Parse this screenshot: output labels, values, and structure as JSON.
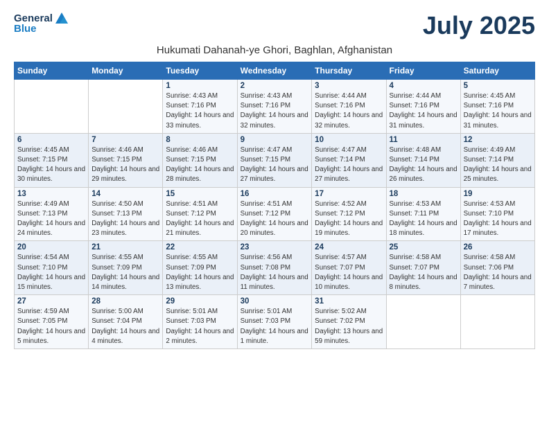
{
  "header": {
    "logo_general": "General",
    "logo_blue": "Blue",
    "month_title": "July 2025",
    "subtitle": "Hukumati Dahanah-ye Ghori, Baghlan, Afghanistan"
  },
  "weekdays": [
    "Sunday",
    "Monday",
    "Tuesday",
    "Wednesday",
    "Thursday",
    "Friday",
    "Saturday"
  ],
  "weeks": [
    [
      {
        "day": "",
        "detail": ""
      },
      {
        "day": "",
        "detail": ""
      },
      {
        "day": "1",
        "detail": "Sunrise: 4:43 AM\nSunset: 7:16 PM\nDaylight: 14 hours and 33 minutes."
      },
      {
        "day": "2",
        "detail": "Sunrise: 4:43 AM\nSunset: 7:16 PM\nDaylight: 14 hours and 32 minutes."
      },
      {
        "day": "3",
        "detail": "Sunrise: 4:44 AM\nSunset: 7:16 PM\nDaylight: 14 hours and 32 minutes."
      },
      {
        "day": "4",
        "detail": "Sunrise: 4:44 AM\nSunset: 7:16 PM\nDaylight: 14 hours and 31 minutes."
      },
      {
        "day": "5",
        "detail": "Sunrise: 4:45 AM\nSunset: 7:16 PM\nDaylight: 14 hours and 31 minutes."
      }
    ],
    [
      {
        "day": "6",
        "detail": "Sunrise: 4:45 AM\nSunset: 7:15 PM\nDaylight: 14 hours and 30 minutes."
      },
      {
        "day": "7",
        "detail": "Sunrise: 4:46 AM\nSunset: 7:15 PM\nDaylight: 14 hours and 29 minutes."
      },
      {
        "day": "8",
        "detail": "Sunrise: 4:46 AM\nSunset: 7:15 PM\nDaylight: 14 hours and 28 minutes."
      },
      {
        "day": "9",
        "detail": "Sunrise: 4:47 AM\nSunset: 7:15 PM\nDaylight: 14 hours and 27 minutes."
      },
      {
        "day": "10",
        "detail": "Sunrise: 4:47 AM\nSunset: 7:14 PM\nDaylight: 14 hours and 27 minutes."
      },
      {
        "day": "11",
        "detail": "Sunrise: 4:48 AM\nSunset: 7:14 PM\nDaylight: 14 hours and 26 minutes."
      },
      {
        "day": "12",
        "detail": "Sunrise: 4:49 AM\nSunset: 7:14 PM\nDaylight: 14 hours and 25 minutes."
      }
    ],
    [
      {
        "day": "13",
        "detail": "Sunrise: 4:49 AM\nSunset: 7:13 PM\nDaylight: 14 hours and 24 minutes."
      },
      {
        "day": "14",
        "detail": "Sunrise: 4:50 AM\nSunset: 7:13 PM\nDaylight: 14 hours and 23 minutes."
      },
      {
        "day": "15",
        "detail": "Sunrise: 4:51 AM\nSunset: 7:12 PM\nDaylight: 14 hours and 21 minutes."
      },
      {
        "day": "16",
        "detail": "Sunrise: 4:51 AM\nSunset: 7:12 PM\nDaylight: 14 hours and 20 minutes."
      },
      {
        "day": "17",
        "detail": "Sunrise: 4:52 AM\nSunset: 7:12 PM\nDaylight: 14 hours and 19 minutes."
      },
      {
        "day": "18",
        "detail": "Sunrise: 4:53 AM\nSunset: 7:11 PM\nDaylight: 14 hours and 18 minutes."
      },
      {
        "day": "19",
        "detail": "Sunrise: 4:53 AM\nSunset: 7:10 PM\nDaylight: 14 hours and 17 minutes."
      }
    ],
    [
      {
        "day": "20",
        "detail": "Sunrise: 4:54 AM\nSunset: 7:10 PM\nDaylight: 14 hours and 15 minutes."
      },
      {
        "day": "21",
        "detail": "Sunrise: 4:55 AM\nSunset: 7:09 PM\nDaylight: 14 hours and 14 minutes."
      },
      {
        "day": "22",
        "detail": "Sunrise: 4:55 AM\nSunset: 7:09 PM\nDaylight: 14 hours and 13 minutes."
      },
      {
        "day": "23",
        "detail": "Sunrise: 4:56 AM\nSunset: 7:08 PM\nDaylight: 14 hours and 11 minutes."
      },
      {
        "day": "24",
        "detail": "Sunrise: 4:57 AM\nSunset: 7:07 PM\nDaylight: 14 hours and 10 minutes."
      },
      {
        "day": "25",
        "detail": "Sunrise: 4:58 AM\nSunset: 7:07 PM\nDaylight: 14 hours and 8 minutes."
      },
      {
        "day": "26",
        "detail": "Sunrise: 4:58 AM\nSunset: 7:06 PM\nDaylight: 14 hours and 7 minutes."
      }
    ],
    [
      {
        "day": "27",
        "detail": "Sunrise: 4:59 AM\nSunset: 7:05 PM\nDaylight: 14 hours and 5 minutes."
      },
      {
        "day": "28",
        "detail": "Sunrise: 5:00 AM\nSunset: 7:04 PM\nDaylight: 14 hours and 4 minutes."
      },
      {
        "day": "29",
        "detail": "Sunrise: 5:01 AM\nSunset: 7:03 PM\nDaylight: 14 hours and 2 minutes."
      },
      {
        "day": "30",
        "detail": "Sunrise: 5:01 AM\nSunset: 7:03 PM\nDaylight: 14 hours and 1 minute."
      },
      {
        "day": "31",
        "detail": "Sunrise: 5:02 AM\nSunset: 7:02 PM\nDaylight: 13 hours and 59 minutes."
      },
      {
        "day": "",
        "detail": ""
      },
      {
        "day": "",
        "detail": ""
      }
    ]
  ]
}
